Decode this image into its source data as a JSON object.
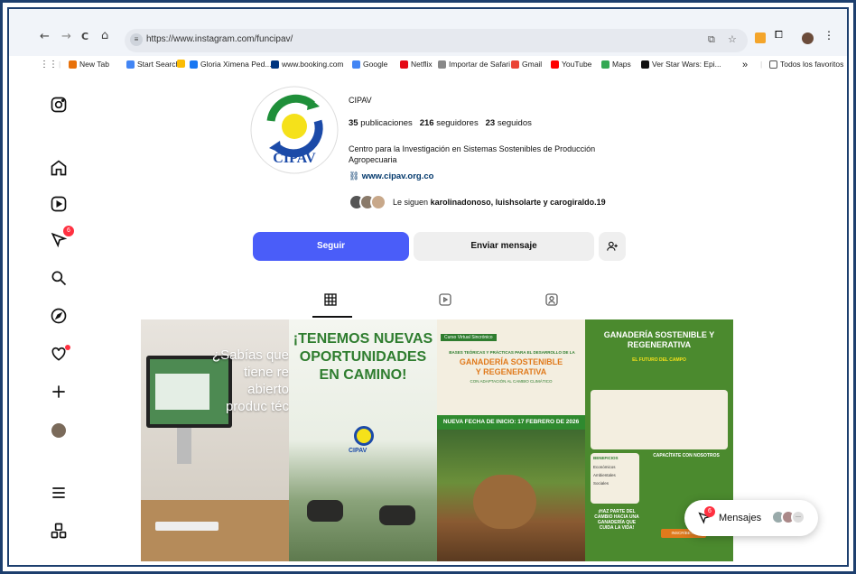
{
  "browser": {
    "back": "←",
    "forward": "→",
    "reload": "C",
    "home": "⌂",
    "url": "https://www.instagram.com/funcipav/",
    "bookmarks": [
      {
        "label": "New Tab",
        "color": "#e8710a"
      },
      {
        "label": "Start Search",
        "color": "#4285f4"
      },
      {
        "label": "",
        "color": "#fbbc04"
      },
      {
        "label": "Gloria Ximena Ped...",
        "color": "#1877f2"
      },
      {
        "label": "www.booking.com",
        "color": "#003580"
      },
      {
        "label": "Google",
        "color": "#4285f4"
      },
      {
        "label": "Netflix",
        "color": "#e50914"
      },
      {
        "label": "Importar de Safari",
        "color": "#888888"
      },
      {
        "label": "Gmail",
        "color": "#ea4335"
      },
      {
        "label": "YouTube",
        "color": "#ff0000"
      },
      {
        "label": "Maps",
        "color": "#34a853"
      },
      {
        "label": "Ver Star Wars: Epi...",
        "color": "#111111"
      }
    ],
    "more": "»",
    "all_bookmarks": "Todos los favoritos"
  },
  "profile": {
    "name": "CIPAV",
    "posts_count": "35",
    "posts_label": "publicaciones",
    "followers_count": "216",
    "followers_label": "seguidores",
    "following_count": "23",
    "following_label": "seguidos",
    "bio_line1": "Centro para la Investigación en Sistemas Sostenibles de Producción",
    "bio_line2": "Agropecuaria",
    "link": "www.cipav.org.co",
    "followed_by_prefix": "Le siguen",
    "followed_by_names": "karolinadonoso, luishsolarte y carogiraldo.19",
    "logo_text": "CIPAV"
  },
  "actions": {
    "follow": "Seguir",
    "message": "Enviar mensaje",
    "add_user": "+&"
  },
  "leftnav": {
    "notifications_badge": "6"
  },
  "posts": {
    "p1_text": "¿Sabías que tiene re abierto produc téc",
    "p2_l1": "¡TENEMOS NUEVAS",
    "p2_l2": "OPORTUNIDADES",
    "p2_l3": "EN CAMINO!",
    "p2_logo": "CIPAV",
    "p3_tag": "Curso Virtual Sincrónico",
    "p3_sub": "BASES TEÓRICAS Y PRÁCTICAS PARA EL DESARROLLO DE LA",
    "p3_t1": "GANADERÍA SOSTENIBLE",
    "p3_t2": "Y REGENERATIVA",
    "p3_t3": "CON ADAPTACIÓN AL CAMBIO CLIMÁTICO",
    "p3_date": "NUEVA FECHA DE INICIO: 17 FEBRERO DE 2026",
    "p4_t1": "GANADERÍA SOSTENIBLE Y",
    "p4_t2": "REGENERATIVA",
    "p4_sub": "EL FUTURO DEL CAMPO",
    "p4_benef": "BENEFICIOS",
    "p4_b1": "Económicos",
    "p4_b2": "Ambientales",
    "p4_b3": "Sociales",
    "p4_cap": "CAPACÍTATE CON NOSOTROS",
    "p4_cta1": "¡HAZ PARTE DEL",
    "p4_cta2": "CAMBIO HACIA UNA",
    "p4_cta3": "GANADERÍA QUE",
    "p4_cta4": "CUIDA LA VIDA!",
    "p4_btn": "INSCRÍBETE"
  },
  "messages": {
    "label": "Mensajes",
    "badge": "6",
    "more": "···"
  }
}
